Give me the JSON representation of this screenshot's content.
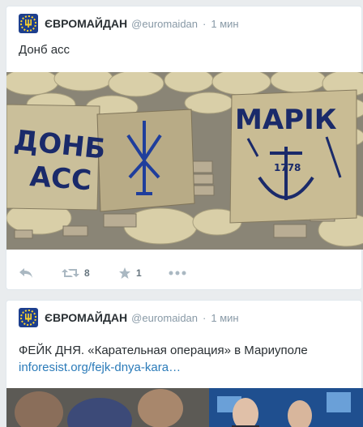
{
  "tweets": [
    {
      "author_name": "ЄВРОМАЙДАН",
      "handle": "@euromaidan",
      "separator": "·",
      "time": "1 мин",
      "text": "Донб асс",
      "media": {
        "graffiti_left": "ДОНБ АСС",
        "graffiti_right": "МАРІК",
        "anchor_label": "1778"
      },
      "actions": {
        "retweet_count": "8",
        "favorite_count": "1"
      }
    },
    {
      "author_name": "ЄВРОМАЙДАН",
      "handle": "@euromaidan",
      "separator": "·",
      "time": "1 мин",
      "text": "ФЕЙК ДНЯ. «Карательная операция» в Мариуполе",
      "link": "inforesist.org/fejk-dnya-kara…"
    }
  ],
  "colors": {
    "background": "#e9ecee",
    "name": "#292f33",
    "meta": "#8899a6",
    "link": "#2b7bb9",
    "icon": "#aab8c2",
    "graffiti": "#1a2a6a"
  },
  "icons": [
    "reply-icon",
    "retweet-icon",
    "favorite-icon",
    "more-icon",
    "eu-avatar"
  ]
}
